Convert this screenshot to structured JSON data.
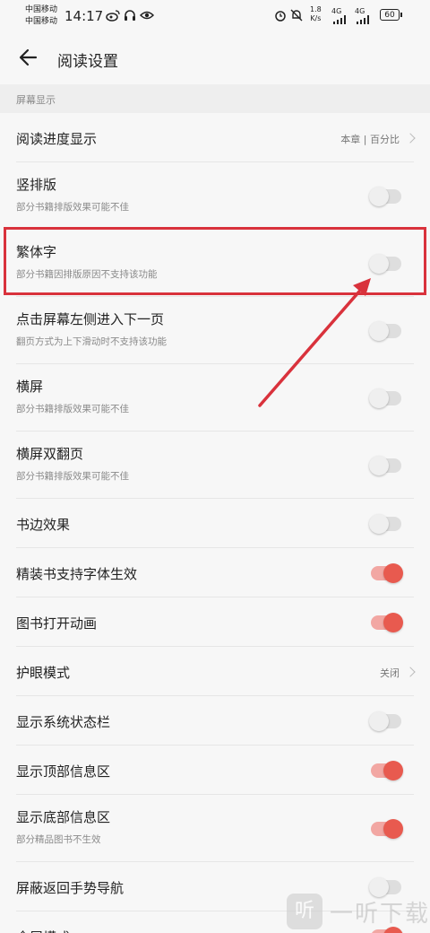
{
  "status_bar": {
    "carrier_1": "中国移动",
    "carrier_2": "中国移动",
    "time": "14:17",
    "net_speed_value": "1.8",
    "net_speed_unit": "K/s",
    "signal_1": "4G",
    "signal_2": "4G",
    "battery": "60",
    "icons": [
      "weibo-icon",
      "headset-icon",
      "eye-icon",
      "alarm-icon",
      "mute-bell-icon",
      "wifi-signal-icon"
    ]
  },
  "header": {
    "title": "阅读设置",
    "back_icon": "arrow-left-icon"
  },
  "section": {
    "label": "屏幕显示"
  },
  "rows": [
    {
      "title": "阅读进度显示",
      "value": "本章 | 百分比"
    },
    {
      "title": "竖排版",
      "subtitle": "部分书籍排版效果可能不佳",
      "toggle": "off"
    },
    {
      "title": "繁体字",
      "subtitle": "部分书籍因排版原因不支持该功能",
      "toggle": "off"
    },
    {
      "title": "点击屏幕左侧进入下一页",
      "subtitle": "翻页方式为上下滑动时不支持该功能",
      "toggle": "off"
    },
    {
      "title": "横屏",
      "subtitle": "部分书籍排版效果可能不佳",
      "toggle": "off"
    },
    {
      "title": "横屏双翻页",
      "subtitle": "部分书籍排版效果可能不佳",
      "toggle": "off"
    },
    {
      "title": "书边效果",
      "toggle": "off"
    },
    {
      "title": "精装书支持字体生效",
      "toggle": "on"
    },
    {
      "title": "图书打开动画",
      "toggle": "on"
    },
    {
      "title": "护眼模式",
      "value": "关闭"
    },
    {
      "title": "显示系统状态栏",
      "toggle": "off"
    },
    {
      "title": "显示顶部信息区",
      "toggle": "on"
    },
    {
      "title": "显示底部信息区",
      "subtitle": "部分精品图书不生效",
      "toggle": "on"
    },
    {
      "title": "屏蔽返回手势导航",
      "toggle": "off"
    },
    {
      "title": "全屏模式",
      "toggle": "on"
    }
  ],
  "watermark": {
    "logo": "听",
    "text": "一听下载"
  },
  "colors": {
    "accent": "#e85a4f",
    "highlight": "#d9323c"
  }
}
